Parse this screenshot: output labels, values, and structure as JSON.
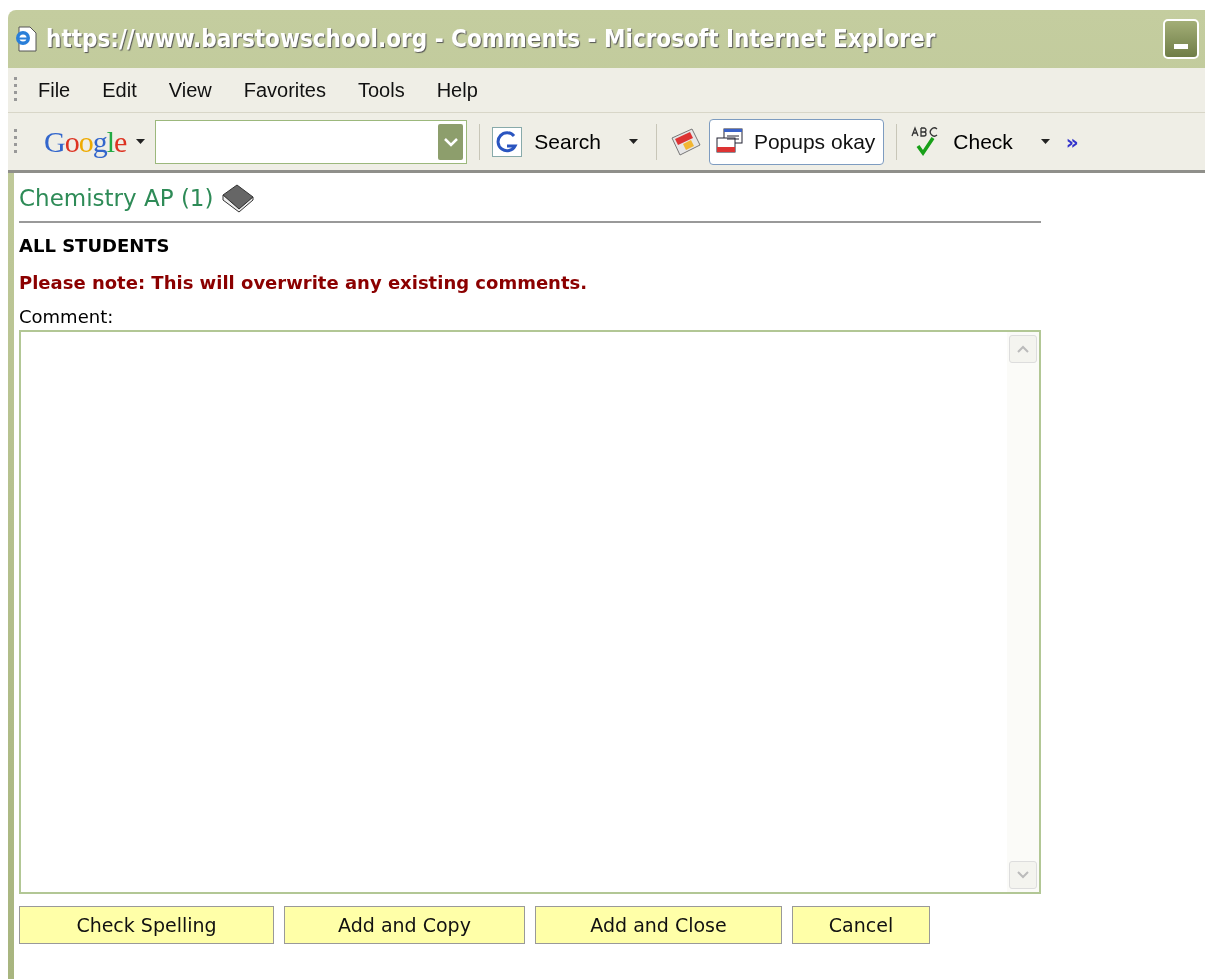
{
  "window": {
    "title": "https://www.barstowschool.org - Comments - Microsoft Internet Explorer"
  },
  "menu": [
    "File",
    "Edit",
    "View",
    "Favorites",
    "Tools",
    "Help"
  ],
  "toolbar": {
    "brand": "Google",
    "search_label": "Search",
    "popup_button": "Popups okay",
    "check_label": "Check",
    "more": "»"
  },
  "page": {
    "heading": "Chemistry AP (1)",
    "group": "ALL STUDENTS",
    "warning": "Please note: This will overwrite any existing comments.",
    "comment_label": "Comment:"
  },
  "buttons": [
    "Check Spelling",
    "Add and Copy",
    "Add and Close",
    "Cancel"
  ]
}
